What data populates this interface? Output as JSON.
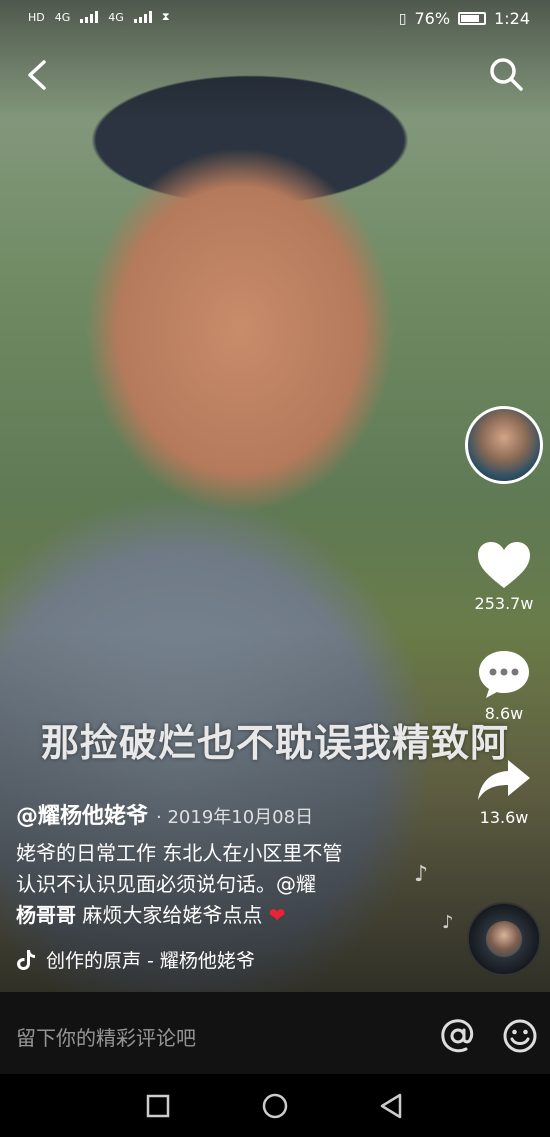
{
  "status_bar": {
    "left_indicators": [
      "HD",
      "4G",
      "4G"
    ],
    "battery": "76%",
    "time": "1:24"
  },
  "video": {
    "subtitle": "那捡破烂也不耽误我精致阿"
  },
  "actions": {
    "likes": "253.7w",
    "comments": "8.6w",
    "shares": "13.6w"
  },
  "post": {
    "author": "@耀杨他姥爷",
    "date": "· 2019年10月08日",
    "description_line1": "姥爷的日常工作 东北人在小区里不管",
    "description_line2": "认识不认识见面必须说句话。@耀",
    "description_line3_bold": "杨哥哥",
    "description_line3_rest": " 麻烦大家给姥爷点点",
    "music": "创作的原声 - 耀杨他姥爷"
  },
  "comment_bar": {
    "placeholder": "留下你的精彩评论吧"
  },
  "colors": {
    "heart": "#ee2233",
    "comment_bar_bg": "#121212"
  }
}
